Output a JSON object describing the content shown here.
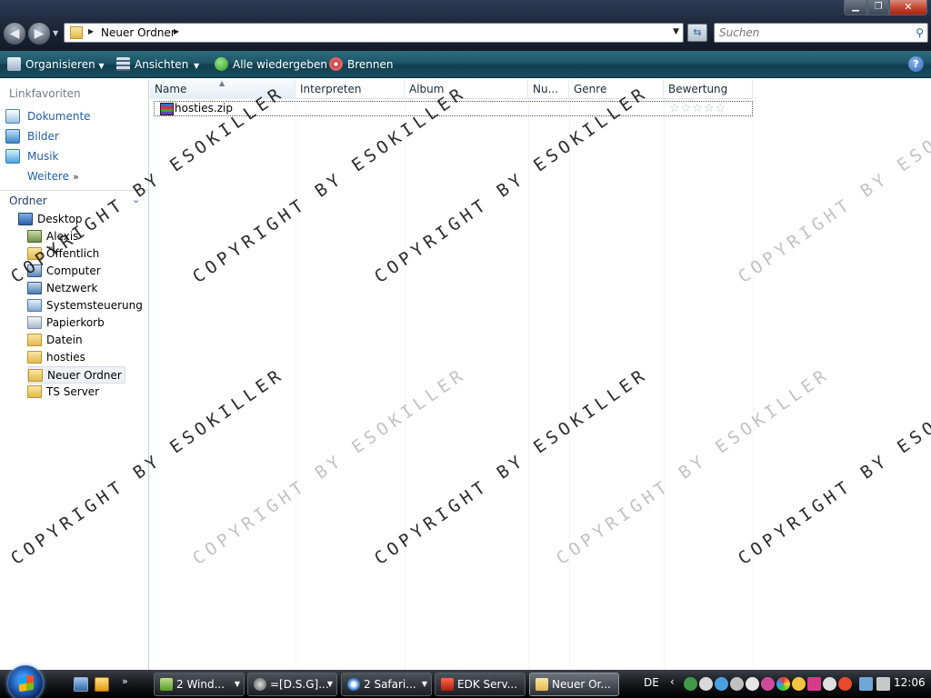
{
  "address": {
    "path": "Neuer Ordner",
    "search_placeholder": "Suchen"
  },
  "commands": {
    "organize": "Organisieren",
    "views": "Ansichten",
    "play_all": "Alle wiedergeben",
    "burn": "Brennen",
    "help": "?"
  },
  "navigation": {
    "favorites_heading": "Linkfavoriten",
    "favorites": [
      "Dokumente",
      "Bilder",
      "Musik"
    ],
    "more_label": "Weitere",
    "folders_heading": "Ordner",
    "tree": [
      {
        "label": "Desktop",
        "icon": "desktop-icon"
      },
      {
        "label": "Alexis",
        "icon": "user-folder-icon"
      },
      {
        "label": "Öffentlich",
        "icon": "folder-icon"
      },
      {
        "label": "Computer",
        "icon": "computer-icon"
      },
      {
        "label": "Netzwerk",
        "icon": "network-icon"
      },
      {
        "label": "Systemsteuerung",
        "icon": "control-panel-icon"
      },
      {
        "label": "Papierkorb",
        "icon": "recycle-bin-icon"
      },
      {
        "label": "Datein",
        "icon": "folder-icon"
      },
      {
        "label": "hosties",
        "icon": "folder-icon"
      },
      {
        "label": "Neuer Ordner",
        "icon": "folder-icon"
      },
      {
        "label": "TS Server",
        "icon": "folder-icon"
      }
    ]
  },
  "file_list": {
    "columns": [
      "Name",
      "Interpreten",
      "Album",
      "Nu...",
      "Genre",
      "Bewertung"
    ],
    "rows": [
      {
        "name": "hosties.zip",
        "rating_stars": "☆☆☆☆☆",
        "rating": 0
      }
    ]
  },
  "watermark_text": "COPYRIGHT BY ESOKILLER",
  "taskbar": {
    "buttons": [
      "2 Wind...",
      "=[D.S.G]...",
      "2 Safari...",
      "EDK Serv...",
      "Neuer Or..."
    ],
    "language": "DE",
    "clock": "12:06"
  },
  "colors": {
    "command_bar": "#1d5566",
    "link_blue": "#1f5fae",
    "title_bar": "#1a2435"
  }
}
